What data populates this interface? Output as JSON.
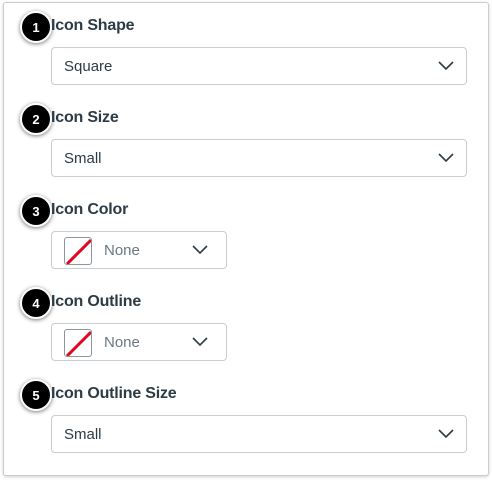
{
  "settings": [
    {
      "step": "1",
      "label": "Icon Shape",
      "type": "select",
      "value": "Square"
    },
    {
      "step": "2",
      "label": "Icon Size",
      "type": "select",
      "value": "Small"
    },
    {
      "step": "3",
      "label": "Icon Color",
      "type": "color",
      "value": "None"
    },
    {
      "step": "4",
      "label": "Icon Outline",
      "type": "color",
      "value": "None"
    },
    {
      "step": "5",
      "label": "Icon Outline Size",
      "type": "select",
      "value": "Small"
    }
  ],
  "colors": {
    "badge": "#000000",
    "text": "#2d3b45",
    "border": "#c7cdd1",
    "none_slash": "#e0061f"
  }
}
